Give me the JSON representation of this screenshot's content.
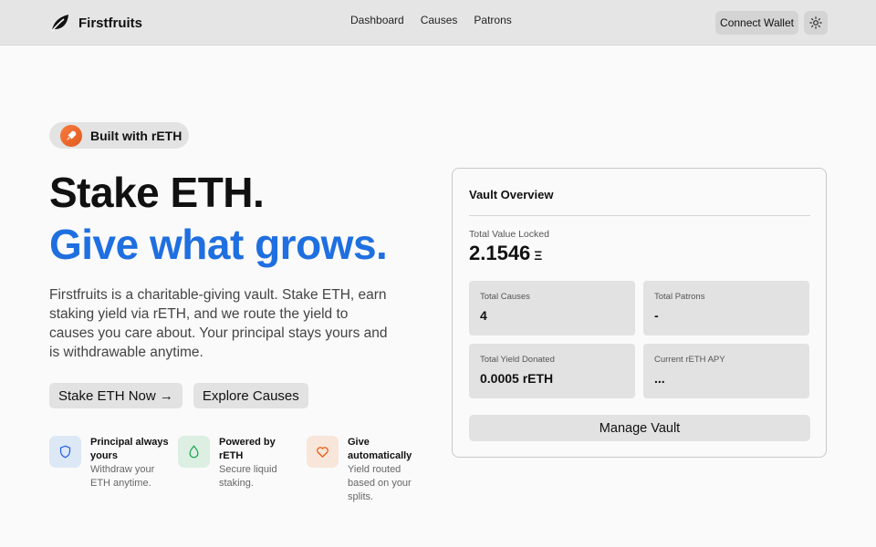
{
  "header": {
    "brand": "Firstfruits",
    "nav": [
      "Dashboard",
      "Causes",
      "Patrons"
    ],
    "connect_wallet": "Connect Wallet",
    "theme_icon": "sun-icon"
  },
  "badge": {
    "label": "Built with rETH",
    "icon": "rocket-icon"
  },
  "hero": {
    "title_line1": "Stake ETH.",
    "title_line2": "Give what grows.",
    "description": "Firstfruits is a charitable-giving vault. Stake ETH, earn staking yield via rETH, and we route the yield to causes you care about. Your principal stays yours and is withdrawable anytime.",
    "cta_primary": "Stake ETH Now →",
    "cta_secondary": "Explore Causes"
  },
  "features": [
    {
      "title": "Principal always yours",
      "subtitle": "Withdraw your ETH anytime.",
      "icon": "shield-icon",
      "color": "#2563eb",
      "bg": "#dde8f7"
    },
    {
      "title": "Powered by rETH",
      "subtitle": "Secure liquid staking.",
      "icon": "droplet-icon",
      "color": "#16a34a",
      "bg": "#dcefe2"
    },
    {
      "title": "Give automatically",
      "subtitle": "Yield routed based on your splits.",
      "icon": "heart-icon",
      "color": "#ea580c",
      "bg": "#f7e6d9"
    }
  ],
  "vault": {
    "title": "Vault Overview",
    "tvl_label": "Total Value Locked",
    "tvl_value": "2.1546",
    "tvl_unit": "Ξ",
    "stats": [
      {
        "label": "Total Causes",
        "value": "4"
      },
      {
        "label": "Total Patrons",
        "value": "-"
      },
      {
        "label": "Total Yield Donated",
        "value": "0.0005 rETH"
      },
      {
        "label": "Current rETH APY",
        "value": "..."
      }
    ],
    "manage_button": "Manage Vault"
  },
  "colors": {
    "accent": "#1f6fe0",
    "badge_orange": "#f26a2a"
  }
}
